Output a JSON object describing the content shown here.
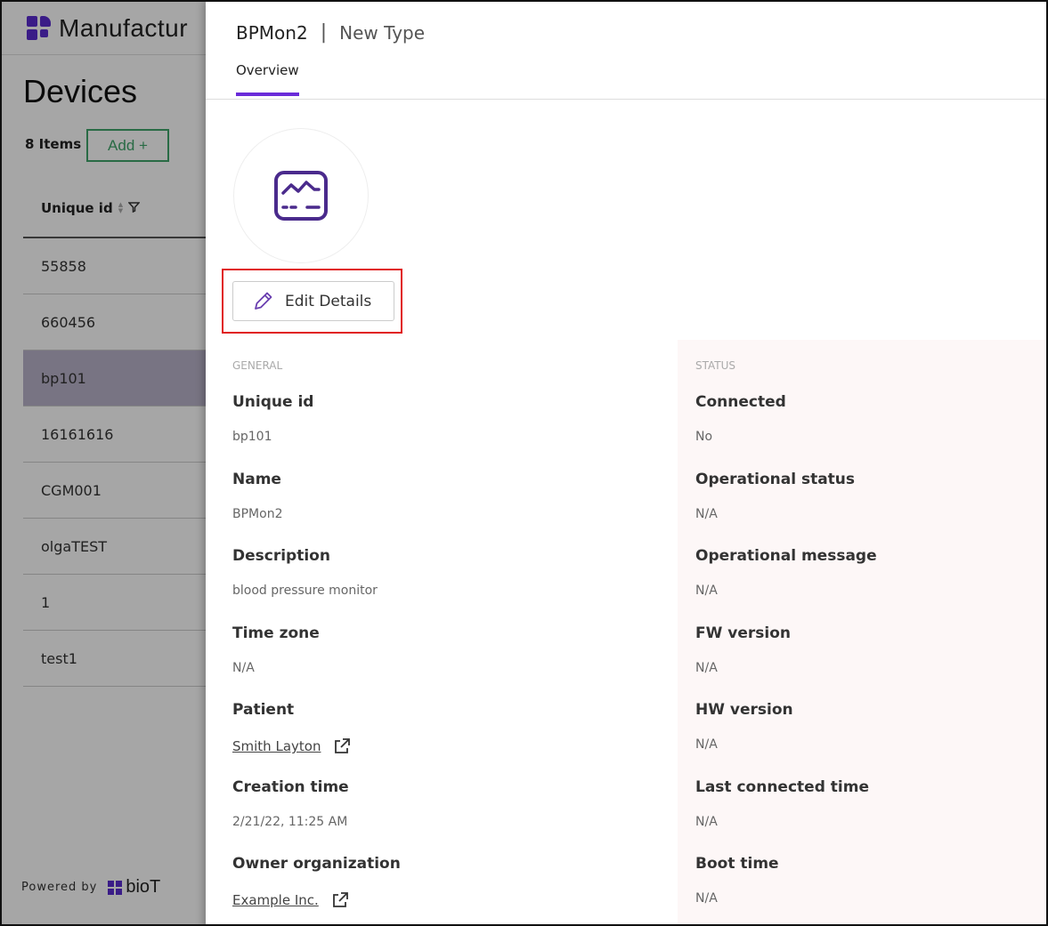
{
  "background_app": {
    "app_name": "Manufactur",
    "page_title": "Devices",
    "item_count": "8 Items",
    "add_label": "Add +",
    "column_header": "Unique id",
    "rows": [
      "55858",
      "660456",
      "bp101",
      "16161616",
      "CGM001",
      "olgaTEST",
      "1",
      "test1"
    ],
    "selected_row": "bp101",
    "powered_by": "Powered by",
    "brand": "bioT"
  },
  "drawer": {
    "device_name": "BPMon2",
    "separator": "|",
    "device_type": "New Type",
    "tab_overview": "Overview",
    "edit_label": "Edit Details",
    "device_icon": "monitor-icon",
    "general": {
      "title": "GENERAL",
      "fields": [
        {
          "label": "Unique id",
          "value": "bp101"
        },
        {
          "label": "Name",
          "value": "BPMon2"
        },
        {
          "label": "Description",
          "value": "blood pressure monitor"
        },
        {
          "label": "Time zone",
          "value": "N/A"
        },
        {
          "label": "Patient",
          "value": "Smith Layton",
          "link": true
        },
        {
          "label": "Creation time",
          "value": "2/21/22, 11:25 AM"
        },
        {
          "label": "Owner organization",
          "value": "Example Inc.",
          "link": true
        }
      ]
    },
    "status": {
      "title": "STATUS",
      "fields": [
        {
          "label": "Connected",
          "value": "No"
        },
        {
          "label": "Operational status",
          "value": "N/A"
        },
        {
          "label": "Operational message",
          "value": "N/A"
        },
        {
          "label": "FW version",
          "value": "N/A"
        },
        {
          "label": "HW version",
          "value": "N/A"
        },
        {
          "label": "Last connected time",
          "value": "N/A"
        },
        {
          "label": "Boot time",
          "value": "N/A"
        }
      ]
    }
  },
  "colors": {
    "accent": "#6a2bd9",
    "brand_purple": "#5a2bd0",
    "add_green": "#3fa56a",
    "highlight_red": "#e01b1b",
    "status_panel": "#fdf7f7"
  }
}
